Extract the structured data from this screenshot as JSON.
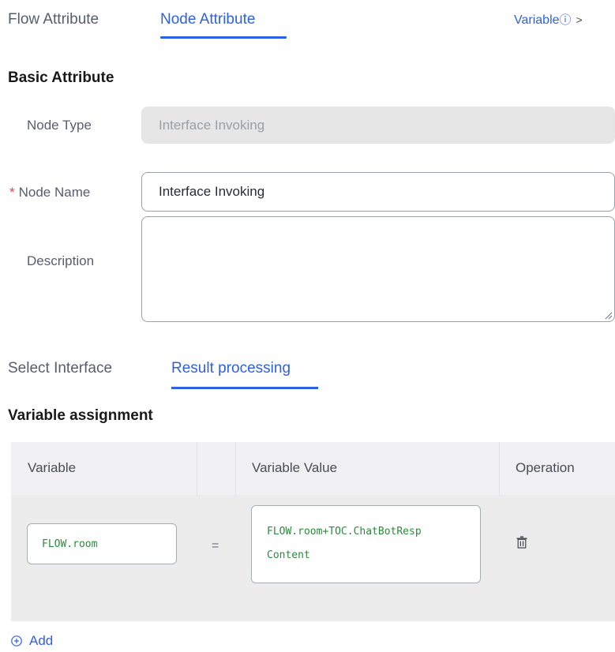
{
  "tabs": {
    "flow": "Flow Attribute",
    "node": "Node Attribute"
  },
  "variable_link": {
    "label": "Variable",
    "info": "ⓘ",
    "chevron": ">"
  },
  "basic": {
    "title": "Basic Attribute",
    "node_type_label": "Node Type",
    "node_type_value": "Interface Invoking",
    "node_name_required": "*",
    "node_name_label": "Node Name",
    "node_name_value": "Interface Invoking",
    "description_label": "Description",
    "description_value": ""
  },
  "subtabs": {
    "select": "Select Interface",
    "result": "Result processing"
  },
  "assignment": {
    "title": "Variable assignment",
    "columns": {
      "variable": "Variable",
      "value": "Variable Value",
      "operation": "Operation"
    },
    "rows": [
      {
        "variable": "FLOW.room",
        "equals": "=",
        "value_line1": "FLOW.room+TOC.ChatBotResp",
        "value_line2": "Content"
      }
    ]
  },
  "add_label": "Add",
  "colors": {
    "accent": "#2e60e6",
    "required": "#e54545",
    "code": "#2c8a3c"
  },
  "icons": {
    "info": "info-circle-icon",
    "chevron": "chevron-right-icon",
    "delete": "trash-icon",
    "add": "plus-circle-icon"
  }
}
